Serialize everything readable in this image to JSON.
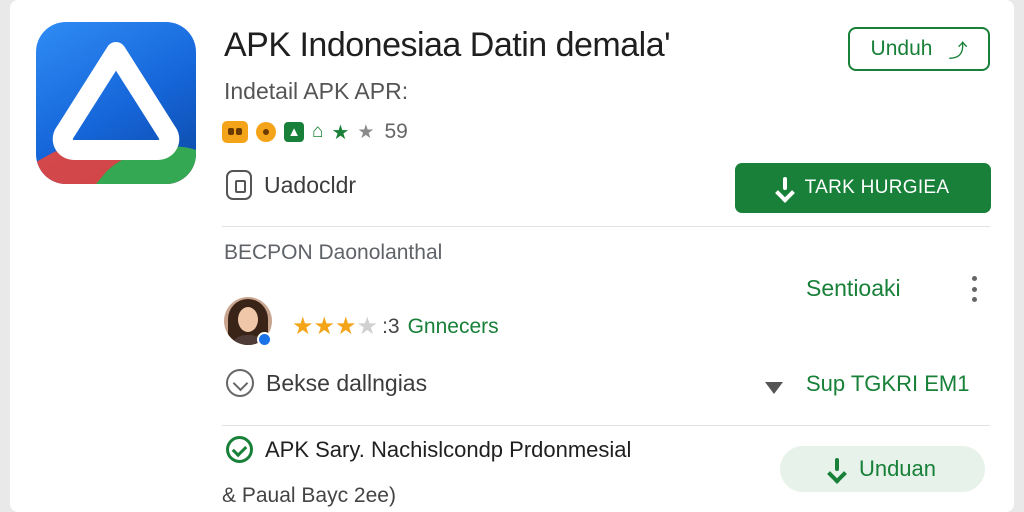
{
  "app": {
    "title": "APK Indonesiaa Datin demala'",
    "subtitle": "Indetail APK APR:",
    "icon_name": "triangle-app-icon",
    "rating_badges": [
      "face-badge-icon",
      "coin-badge-icon",
      "shield-badge-icon",
      "house-icon",
      "star-icon",
      "star-icon"
    ],
    "badge_count": "59",
    "developer": "Uadocldr"
  },
  "actions": {
    "unduh_label": "Unduh",
    "install_label": "TARK HURGIEA",
    "unduan_label": "Unduan"
  },
  "section": {
    "title": "BECPON Daonolanthal",
    "link": "Sentioaki"
  },
  "review": {
    "stars": 3,
    "max_stars": 4,
    "count_text": ":3",
    "label": "Gnnecers",
    "avatar_icon": "user-avatar"
  },
  "info": {
    "label": "Bekse dallngias",
    "meta": "Sup TGKRI EM1"
  },
  "verified": {
    "label": "APK Sary. Nachislcondp Prdonmesial"
  },
  "footer": {
    "text": "& Paual Bayc 2ee)"
  },
  "colors": {
    "primary_green": "#188038",
    "icon_blue": "#1565d8",
    "star_gold": "#f4a418"
  }
}
